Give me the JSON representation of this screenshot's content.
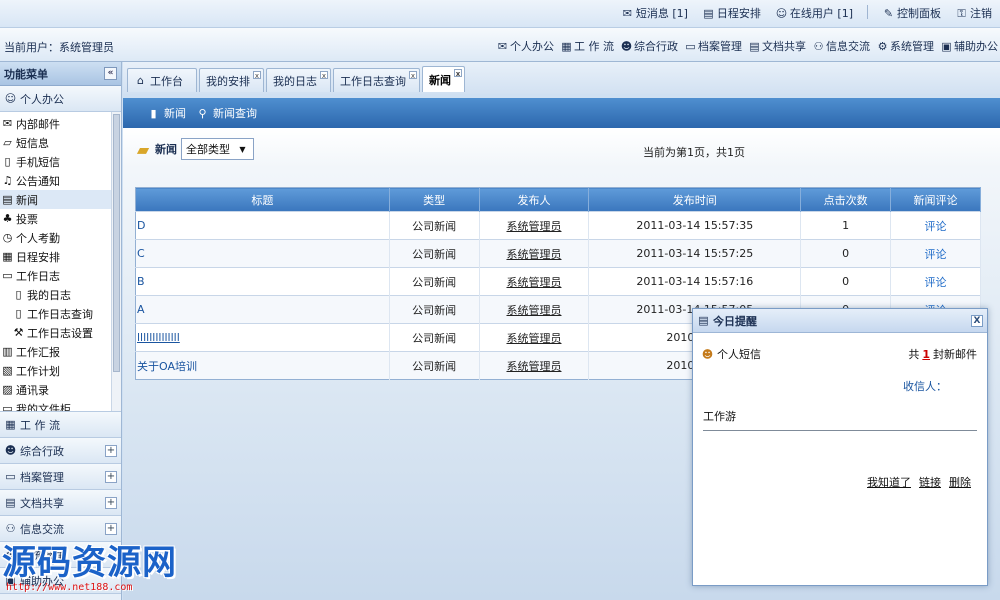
{
  "topbar": {
    "links": [
      {
        "icon": "envelope-icon",
        "label": "短消息 [1]"
      },
      {
        "icon": "calendar-icon",
        "label": "日程安排"
      },
      {
        "icon": "user-icon",
        "label": "在线用户 [1]"
      },
      {
        "icon": "pencil-icon",
        "label": "控制面板"
      },
      {
        "icon": "lock-icon",
        "label": "注销"
      }
    ]
  },
  "userbar": {
    "current_user": "当前用户：系统管理员",
    "modules": [
      {
        "icon": "mail-icon",
        "label": "个人办公"
      },
      {
        "icon": "form-icon",
        "label": "工 作 流"
      },
      {
        "icon": "people-icon",
        "label": "综合行政"
      },
      {
        "icon": "cabinet-icon",
        "label": "档案管理"
      },
      {
        "icon": "document-icon",
        "label": "文档共享"
      },
      {
        "icon": "exchange-icon",
        "label": "信息交流"
      },
      {
        "icon": "gear-icon",
        "label": "系统管理"
      },
      {
        "icon": "tool-icon",
        "label": "辅助办公"
      }
    ]
  },
  "sidebar": {
    "title": "功能菜单",
    "collapse": "«",
    "group_personal": "个人办公",
    "items": [
      {
        "icon": "mail-icon",
        "label": "内部邮件",
        "sub": false
      },
      {
        "icon": "chat-icon",
        "label": "短信息",
        "sub": false
      },
      {
        "icon": "phone-icon",
        "label": "手机短信",
        "sub": false
      },
      {
        "icon": "notice-icon",
        "label": "公告通知",
        "sub": false
      },
      {
        "icon": "news-icon",
        "label": "新闻",
        "sub": false,
        "active": true
      },
      {
        "icon": "vote-icon",
        "label": "投票",
        "sub": false
      },
      {
        "icon": "clock-icon",
        "label": "个人考勤",
        "sub": false
      },
      {
        "icon": "calendar-icon",
        "label": "日程安排",
        "sub": false
      },
      {
        "icon": "folder-icon",
        "label": "工作日志",
        "sub": false
      },
      {
        "icon": "page-icon",
        "label": "我的日志",
        "sub": true
      },
      {
        "icon": "page-icon",
        "label": "工作日志查询",
        "sub": true
      },
      {
        "icon": "settings-icon",
        "label": "工作日志设置",
        "sub": true
      },
      {
        "icon": "report-icon",
        "label": "工作汇报",
        "sub": false
      },
      {
        "icon": "plan-icon",
        "label": "工作计划",
        "sub": false
      },
      {
        "icon": "book-icon",
        "label": "通讯录",
        "sub": false
      },
      {
        "icon": "folder-icon",
        "label": "我的文件柜",
        "sub": false
      }
    ],
    "groups": [
      {
        "icon": "form-icon",
        "label": "工 作 流",
        "plus": ""
      },
      {
        "icon": "people-icon",
        "label": "综合行政",
        "plus": "+"
      },
      {
        "icon": "cabinet-icon",
        "label": "档案管理",
        "plus": "+"
      },
      {
        "icon": "document-icon",
        "label": "文档共享",
        "plus": "+"
      },
      {
        "icon": "exchange-icon",
        "label": "信息交流",
        "plus": "+"
      },
      {
        "icon": "gear-icon",
        "label": "系统管理",
        "plus": ""
      },
      {
        "icon": "tool-icon",
        "label": "辅助办公",
        "plus": ""
      }
    ]
  },
  "tabs": [
    {
      "label": "工作台",
      "icon": "home-icon",
      "closable": false
    },
    {
      "label": "我的安排",
      "closable": true
    },
    {
      "label": "我的日志",
      "closable": true
    },
    {
      "label": "工作日志查询",
      "closable": true
    },
    {
      "label": "新闻",
      "closable": true,
      "active": true
    }
  ],
  "toolbar": {
    "news": "新闻",
    "news_query": "新闻查询"
  },
  "content": {
    "section_label": "新闻",
    "type_select": "全部类型",
    "page_info": "当前为第1页，共1页",
    "columns": [
      "标题",
      "类型",
      "发布人",
      "发布时间",
      "点击次数",
      "新闻评论"
    ],
    "rows": [
      {
        "title": "D",
        "type": "公司新闻",
        "publisher": "系统管理员",
        "time": "2011-03-14 15:57:35",
        "clicks": "1",
        "comment": "评论"
      },
      {
        "title": "C",
        "type": "公司新闻",
        "publisher": "系统管理员",
        "time": "2011-03-14 15:57:25",
        "clicks": "0",
        "comment": "评论"
      },
      {
        "title": "B",
        "type": "公司新闻",
        "publisher": "系统管理员",
        "time": "2011-03-14 15:57:16",
        "clicks": "0",
        "comment": "评论"
      },
      {
        "title": "A",
        "type": "公司新闻",
        "publisher": "系统管理员",
        "time": "2011-03-14 15:57:05",
        "clicks": "0",
        "comment": "评论"
      },
      {
        "title": "llllllllllllll",
        "type": "公司新闻",
        "publisher": "系统管理员",
        "time": "2010-02-0",
        "clicks": "",
        "comment": ""
      },
      {
        "title": "关于OA培训",
        "type": "公司新闻",
        "publisher": "系统管理员",
        "time": "2010-02-0",
        "clicks": "",
        "comment": ""
      }
    ]
  },
  "popup": {
    "title": "今日提醒",
    "close": "X",
    "sms_label": "个人短信",
    "count_prefix": "共",
    "count_num": "1",
    "count_suffix": "封新邮件",
    "receiver": "收信人：",
    "body_text": "工作游",
    "actions": [
      "我知道了",
      "链接",
      "删除"
    ]
  },
  "watermark": {
    "main": "源码资源网",
    "url": "http://www.net188.com"
  },
  "colors": {
    "accent": "#2c67ad",
    "header_blue": "#3a76bd",
    "link": "#1a55a0",
    "watermark_blue": "#1b62c8",
    "watermark_red": "#dd1111"
  }
}
